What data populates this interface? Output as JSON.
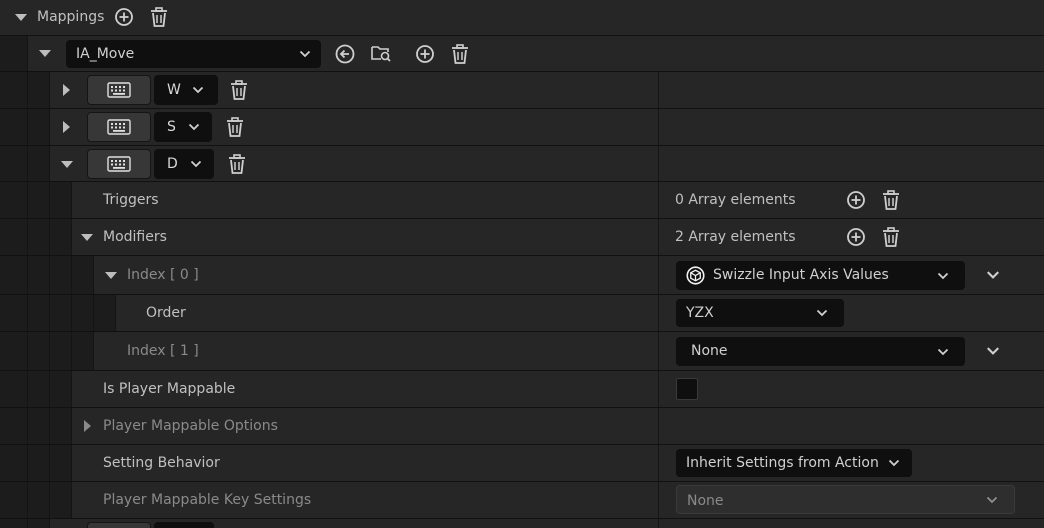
{
  "mappings": {
    "label": "Mappings"
  },
  "action": {
    "value": "IA_Move"
  },
  "keys": [
    {
      "value": "W",
      "expanded": false
    },
    {
      "value": "S",
      "expanded": false
    },
    {
      "value": "D",
      "expanded": true
    }
  ],
  "details": {
    "triggers": {
      "label": "Triggers",
      "count": "0 Array elements"
    },
    "modifiers": {
      "label": "Modifiers",
      "count": "2 Array elements"
    },
    "index0": {
      "label": "Index [ 0 ]",
      "value": "Swizzle Input Axis Values"
    },
    "order": {
      "label": "Order",
      "value": "YZX"
    },
    "index1": {
      "label": "Index [ 1 ]",
      "value": "None"
    },
    "is_player_mappable": {
      "label": "Is Player Mappable",
      "checked": false
    },
    "player_mappable_options": {
      "label": "Player Mappable Options"
    },
    "setting_behavior": {
      "label": "Setting Behavior",
      "value": "Inherit Settings from Action"
    },
    "player_mappable_key_settings": {
      "label": "Player Mappable Key Settings",
      "value": "None"
    }
  },
  "icons": {
    "add": "plus-circle-icon",
    "delete": "trash-icon",
    "keyboard": "keyboard-icon",
    "reset": "arrow-left-circle-icon",
    "browse": "folder-search-icon",
    "modifier_class": "unreal-logo-icon"
  },
  "colors": {
    "panel": "#262626",
    "field": "#0f0f0f",
    "text": "#c0c0c0"
  }
}
